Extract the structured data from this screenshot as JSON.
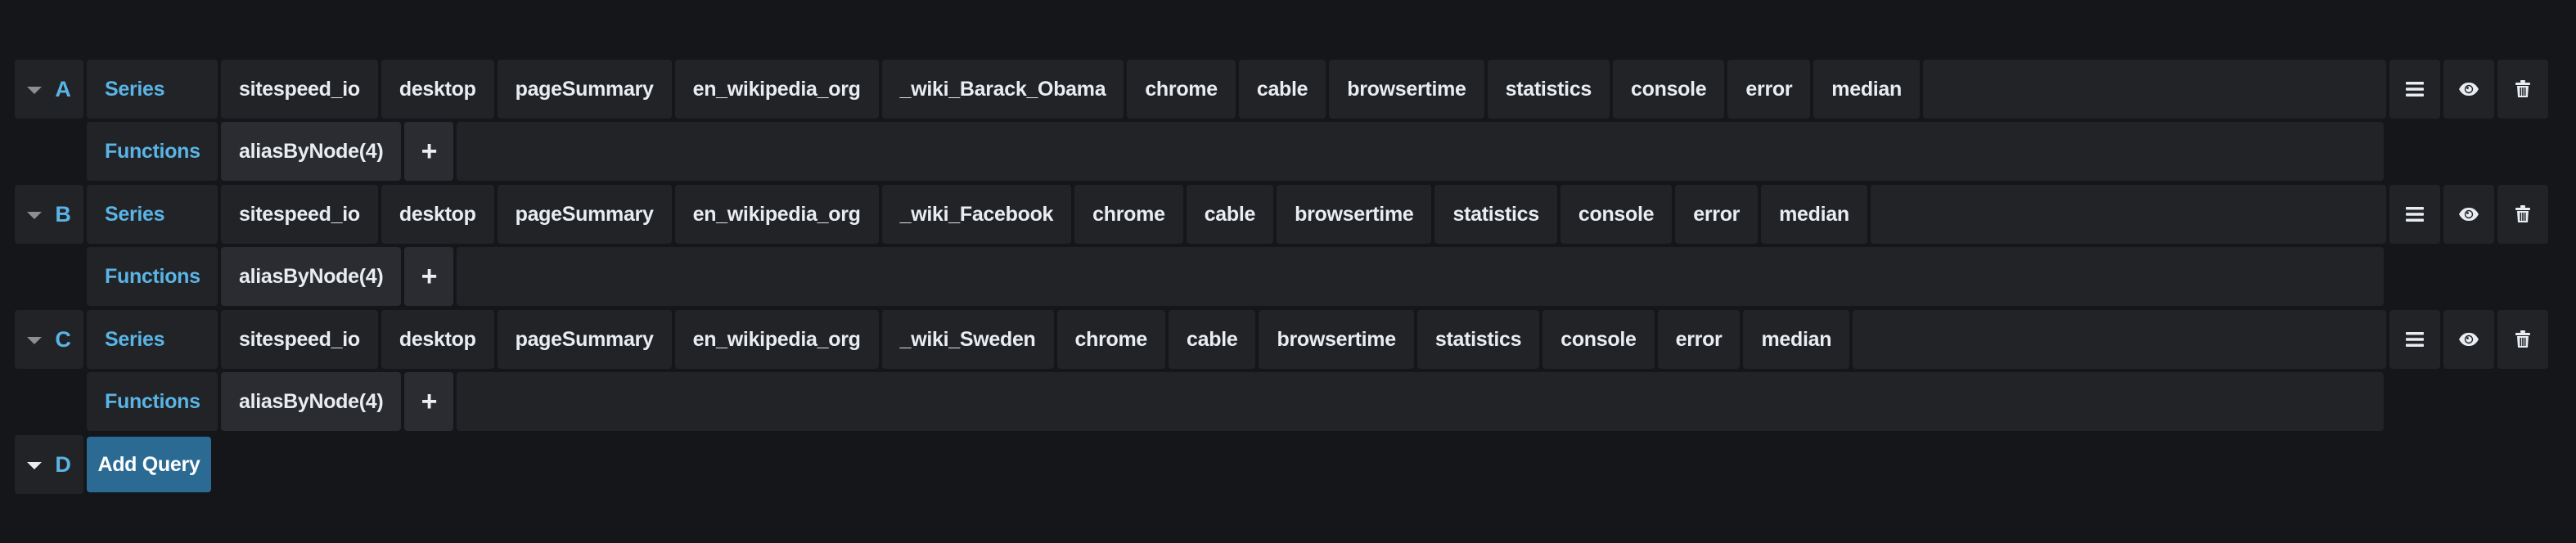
{
  "queries": [
    {
      "ref_id": "A",
      "series_label": "Series",
      "segments": [
        "sitespeed_io",
        "desktop",
        "pageSummary",
        "en_wikipedia_org",
        "_wiki_Barack_Obama",
        "chrome",
        "cable",
        "browsertime",
        "statistics",
        "console",
        "error",
        "median"
      ],
      "functions_label": "Functions",
      "functions": [
        "aliasByNode(4)"
      ],
      "add_function_label": "+"
    },
    {
      "ref_id": "B",
      "series_label": "Series",
      "segments": [
        "sitespeed_io",
        "desktop",
        "pageSummary",
        "en_wikipedia_org",
        "_wiki_Facebook",
        "chrome",
        "cable",
        "browsertime",
        "statistics",
        "console",
        "error",
        "median"
      ],
      "functions_label": "Functions",
      "functions": [
        "aliasByNode(4)"
      ],
      "add_function_label": "+"
    },
    {
      "ref_id": "C",
      "series_label": "Series",
      "segments": [
        "sitespeed_io",
        "desktop",
        "pageSummary",
        "en_wikipedia_org",
        "_wiki_Sweden",
        "chrome",
        "cable",
        "browsertime",
        "statistics",
        "console",
        "error",
        "median"
      ],
      "functions_label": "Functions",
      "functions": [
        "aliasByNode(4)"
      ],
      "add_function_label": "+"
    }
  ],
  "new_query": {
    "ref_id": "D",
    "add_query_label": "Add Query"
  },
  "row_actions": [
    {
      "name": "menu",
      "icon": "hamburger-menu-icon"
    },
    {
      "name": "toggle-visibility",
      "icon": "eye-icon"
    },
    {
      "name": "delete",
      "icon": "trash-icon"
    }
  ],
  "colors": {
    "background": "#141619",
    "cell": "#212327",
    "accent_text": "#5ab4e5",
    "primary_button": "#2b6b93"
  }
}
